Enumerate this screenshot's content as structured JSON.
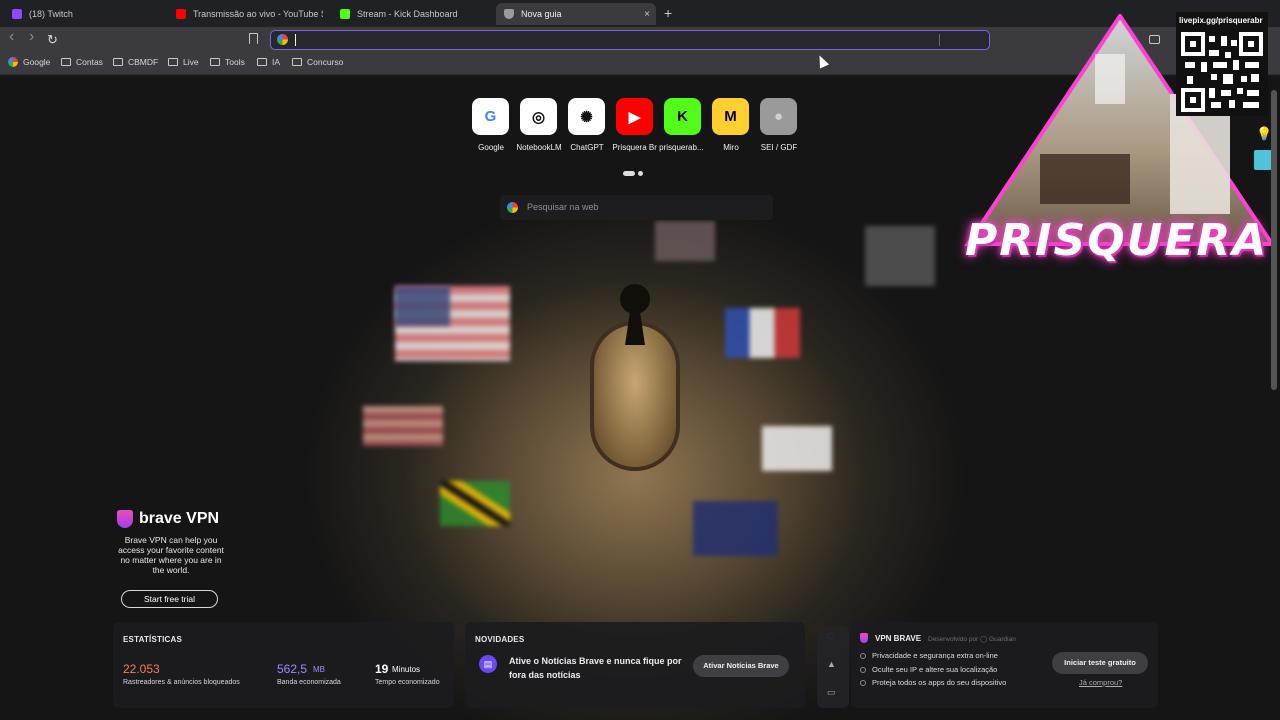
{
  "tabs": [
    {
      "title": "(18) Twitch",
      "color": "#9146ff"
    },
    {
      "title": "Transmissão ao vivo - YouTube Studio",
      "color": "#ff0000"
    },
    {
      "title": "Stream - Kick Dashboard",
      "color": "#53fc18"
    },
    {
      "title": "Nova guia",
      "color": "#9a9aa0",
      "close": "×"
    }
  ],
  "new_tab_symbol": "+",
  "nav": {
    "back": "‹",
    "forward": "›",
    "reload": "↻"
  },
  "bookmarks": [
    "Google",
    "Contas",
    "CBMDF",
    "Live",
    "Tools",
    "IA",
    "Concurso"
  ],
  "quick_sites": [
    {
      "label": "Google",
      "glyph": "G",
      "bg": "#ffffff",
      "fg": "#4285f4"
    },
    {
      "label": "NotebookLM",
      "glyph": "◎",
      "bg": "#ffffff",
      "fg": "#111111"
    },
    {
      "label": "ChatGPT",
      "glyph": "✺",
      "bg": "#ffffff",
      "fg": "#111111"
    },
    {
      "label": "Prisquera Br prisquerab...",
      "glyph": "▶",
      "bg": "#ff0000",
      "fg": "#ffffff"
    },
    {
      "label": "Kick",
      "glyph": "K",
      "bg": "#53fc18",
      "fg": "#000000"
    },
    {
      "label": "Miro",
      "glyph": "M",
      "bg": "#ffd02f",
      "fg": "#050038"
    },
    {
      "label": "SEI / GDF",
      "glyph": "●",
      "bg": "#9a9a9a",
      "fg": "#d0d0d0"
    }
  ],
  "search_placeholder": "Pesquisar na web",
  "vpn_promo": {
    "brand": "brave VPN",
    "text": "Brave VPN can help you access your favorite content no matter where you are in the world.",
    "button": "Start free trial"
  },
  "stats": {
    "heading": "ESTATÍSTICAS",
    "trackers": {
      "value": "22.053",
      "label": "Rastreadores & anúncios bloqueados",
      "color": "#ff7a50"
    },
    "bandwidth": {
      "value": "562,5",
      "unit": "MB",
      "label": "Banda economizada",
      "color": "#9b8cff"
    },
    "time": {
      "value": "19",
      "unit": "Minutos",
      "label": "Tempo economizado",
      "color": "#ffffff"
    }
  },
  "news": {
    "heading": "NOVIDADES",
    "text": "Ative o Notícias Brave e nunca fique por fora das notícias",
    "button": "Ativar Notícias Brave"
  },
  "vpn_card": {
    "title": "VPN BRAVE",
    "dev": "Desenvolvido por ◯ Guardian",
    "bullets": [
      "Privacidade e segurança extra on-line",
      "Oculte seu IP e altere sua localização",
      "Proteja todos os apps do seu dispositivo"
    ],
    "button": "Iniciar teste gratuito",
    "link": "Já comprou?"
  },
  "stream_overlay": {
    "name": "PRISQUERA",
    "qr_url": "livepix.gg/prisquerabr"
  }
}
